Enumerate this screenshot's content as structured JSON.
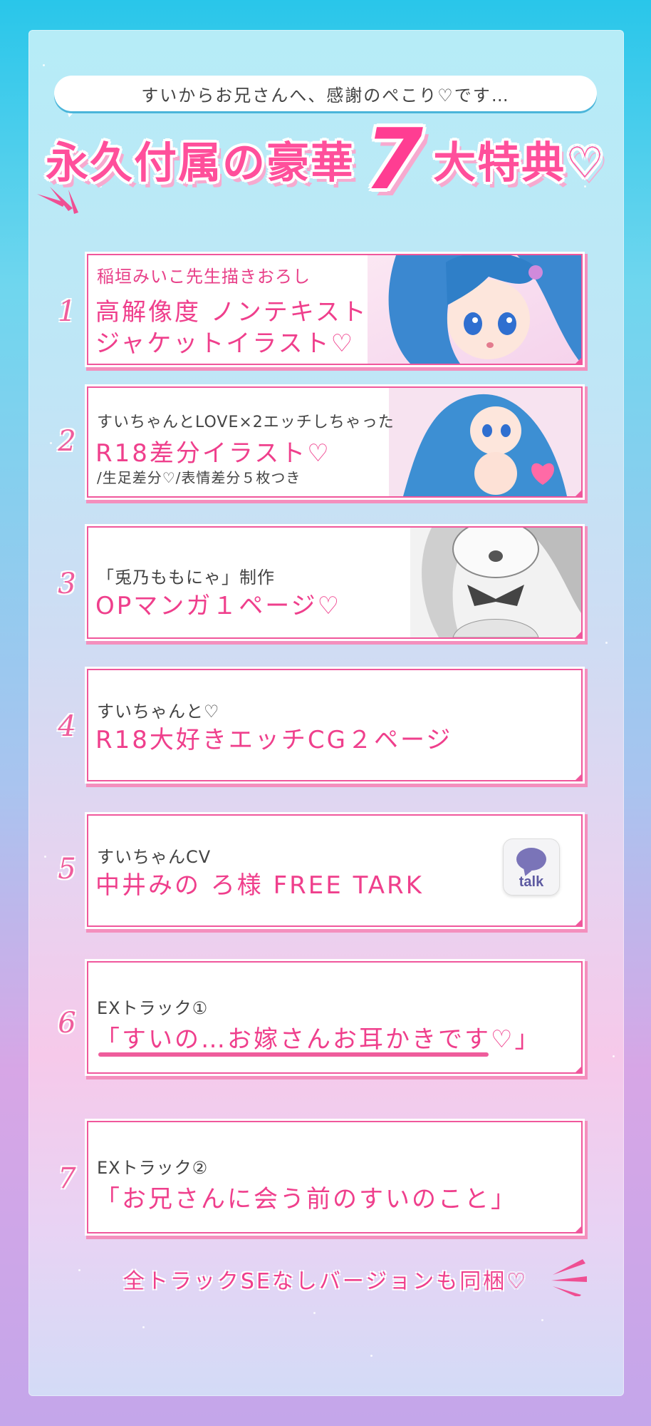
{
  "header": {
    "bubble_text": "すいからお兄さんへ、感謝のぺこり♡です…",
    "headline_left": "永久付属の豪華",
    "headline_number": "7",
    "headline_right": "大特典♡"
  },
  "items": [
    {
      "number": "1",
      "sub": "稲垣みいこ先生描きおろし",
      "main_line1": "高解像度 ノンテキスト",
      "main_line2": "ジャケットイラスト♡"
    },
    {
      "number": "2",
      "sub": "すいちゃんとLOVE×2エッチしちゃった",
      "main": "R18差分イラスト♡",
      "note": "/生足差分♡/表情差分５枚つき"
    },
    {
      "number": "3",
      "sub": "「兎乃ももにゃ」制作",
      "main": "OPマンガ１ページ♡"
    },
    {
      "number": "4",
      "sub": "すいちゃんと♡",
      "main": "R18大好きエッチCG２ページ"
    },
    {
      "number": "5",
      "sub": "すいちゃんCV",
      "main": "中井みの ろ様 FREE TARK",
      "badge": "talk"
    },
    {
      "number": "6",
      "sub": "EXトラック①",
      "main": "「すいの…お嫁さんお耳かきです♡」"
    },
    {
      "number": "7",
      "sub": "EXトラック②",
      "main": "「お兄さんに会う前のすいのこと」"
    }
  ],
  "footer": {
    "text": "全トラックSEなしバージョンも同梱♡"
  },
  "colors": {
    "accent_pink": "#ef3f8c",
    "panel_top": "#b6ecf7",
    "panel_bottom": "#d3dbf6"
  }
}
